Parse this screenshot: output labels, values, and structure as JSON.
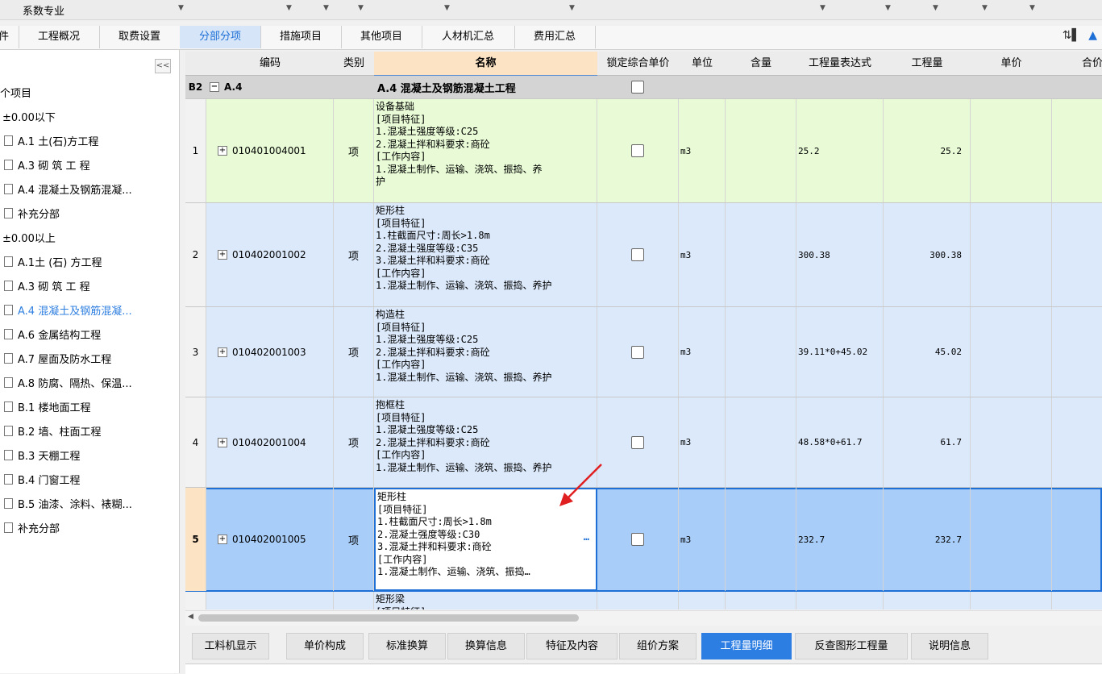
{
  "top_bar": {
    "specialty_label": "系数专业"
  },
  "tabs": [
    {
      "label": "件"
    },
    {
      "label": "工程概况"
    },
    {
      "label": "取费设置"
    },
    {
      "label": "分部分项"
    },
    {
      "label": "措施项目"
    },
    {
      "label": "其他项目"
    },
    {
      "label": "人材机汇总"
    },
    {
      "label": "费用汇总"
    }
  ],
  "sidebar": {
    "collapse_label": "<<",
    "items": [
      {
        "label": "个项目"
      },
      {
        "label": "±0.00以下"
      },
      {
        "label": "A.1 土(石)方工程"
      },
      {
        "label": "A.3 砌 筑 工 程"
      },
      {
        "label": "A.4 混凝土及钢筋混凝..."
      },
      {
        "label": "补充分部"
      },
      {
        "label": "±0.00以上"
      },
      {
        "label": "A.1土 (石) 方工程"
      },
      {
        "label": "A.3 砌 筑 工 程"
      },
      {
        "label": "A.4 混凝土及钢筋混凝..."
      },
      {
        "label": "A.6 金属结构工程"
      },
      {
        "label": "A.7 屋面及防水工程"
      },
      {
        "label": "A.8 防腐、隔热、保温..."
      },
      {
        "label": "B.1 楼地面工程"
      },
      {
        "label": "B.2 墙、柱面工程"
      },
      {
        "label": "B.3 天棚工程"
      },
      {
        "label": "B.4 门窗工程"
      },
      {
        "label": "B.5 油漆、涂料、裱糊..."
      },
      {
        "label": "补充分部"
      }
    ]
  },
  "grid": {
    "headers": [
      "编码",
      "类别",
      "名称",
      "锁定综合单价",
      "单位",
      "含量",
      "工程量表达式",
      "工程量",
      "单价",
      "合价"
    ],
    "section": {
      "num": "B2",
      "code": "A.4",
      "name": "A.4   混凝土及钢筋混凝土工程"
    },
    "rows": [
      {
        "num": "1",
        "code": "010401004001",
        "cat": "项",
        "name": "设备基础\n[项目特征]\n1.混凝土强度等级:C25\n2.混凝土拌和料要求:商砼\n[工作内容]\n1.混凝土制作、运输、浇筑、振捣、养\n护",
        "unit": "m3",
        "expr": "25.2",
        "qty": "25.2"
      },
      {
        "num": "2",
        "code": "010402001002",
        "cat": "项",
        "name": "矩形柱\n[项目特征]\n1.柱截面尺寸:周长>1.8m\n2.混凝土强度等级:C35\n3.混凝土拌和料要求:商砼\n[工作内容]\n1.混凝土制作、运输、浇筑、振捣、养护",
        "unit": "m3",
        "expr": "300.38",
        "qty": "300.38"
      },
      {
        "num": "3",
        "code": "010402001003",
        "cat": "项",
        "name": "构造柱\n[项目特征]\n1.混凝土强度等级:C25\n2.混凝土拌和料要求:商砼\n[工作内容]\n1.混凝土制作、运输、浇筑、振捣、养护",
        "unit": "m3",
        "expr": "39.11*0+45.02",
        "qty": "45.02"
      },
      {
        "num": "4",
        "code": "010402001004",
        "cat": "项",
        "name": "抱框柱\n[项目特征]\n1.混凝土强度等级:C25\n2.混凝土拌和料要求:商砼\n[工作内容]\n1.混凝土制作、运输、浇筑、振捣、养护",
        "unit": "m3",
        "expr": "48.58*0+61.7",
        "qty": "61.7"
      },
      {
        "num": "5",
        "code": "010402001005",
        "cat": "项",
        "name": "矩形柱\n[项目特征]\n1.柱截面尺寸:周长>1.8m\n2.混凝土强度等级:C30\n3.混凝土拌和料要求:商砼\n[工作内容]\n1.混凝土制作、运输、浇筑、振捣…",
        "unit": "m3",
        "expr": "232.7",
        "qty": "232.7",
        "ellipsis": "…"
      },
      {
        "num": "",
        "code": "",
        "cat": "",
        "name": "矩形梁\n[项目特征]",
        "unit": "",
        "expr": "",
        "qty": ""
      }
    ]
  },
  "bottom_tabs": [
    "工料机显示",
    "单价构成",
    "标准换算",
    "换算信息",
    "特征及内容",
    "组价方案",
    "工程量明细",
    "反查图形工程量",
    "说明信息"
  ],
  "colors": {
    "accent": "#2d7ee3",
    "row_green": "#e8fbd6",
    "row_blue": "#dbe9fb",
    "row_selected": "#a8cdf8",
    "arrow_red": "#e02020"
  }
}
